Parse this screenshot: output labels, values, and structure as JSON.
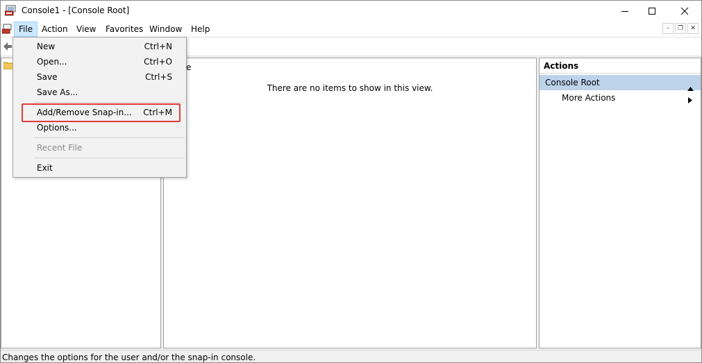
{
  "window": {
    "title": "Console1 - [Console Root]"
  },
  "menubar": {
    "items": [
      {
        "label": "File"
      },
      {
        "label": "Action"
      },
      {
        "label": "View"
      },
      {
        "label": "Favorites"
      },
      {
        "label": "Window"
      },
      {
        "label": "Help"
      }
    ]
  },
  "file_menu": {
    "items": [
      {
        "label": "New",
        "shortcut": "Ctrl+N"
      },
      {
        "label": "Open...",
        "shortcut": "Ctrl+O"
      },
      {
        "label": "Save",
        "shortcut": "Ctrl+S"
      },
      {
        "label": "Save As...",
        "shortcut": ""
      },
      {
        "label": "Add/Remove Snap-in...",
        "shortcut": "Ctrl+M"
      },
      {
        "label": "Options...",
        "shortcut": ""
      },
      {
        "label": "Recent File",
        "shortcut": ""
      },
      {
        "label": "Exit",
        "shortcut": ""
      }
    ]
  },
  "center": {
    "header_fragment": "e",
    "empty_message": "There are no items to show in this view."
  },
  "actions": {
    "header": "Actions",
    "section": "Console Root",
    "more": "More Actions"
  },
  "status": {
    "text": "Changes the options for the user and/or the snap-in console."
  },
  "colors": {
    "highlight_box": "#e23b3b",
    "menu_active": "#cce8ff",
    "actions_section": "#bcd3ea"
  }
}
